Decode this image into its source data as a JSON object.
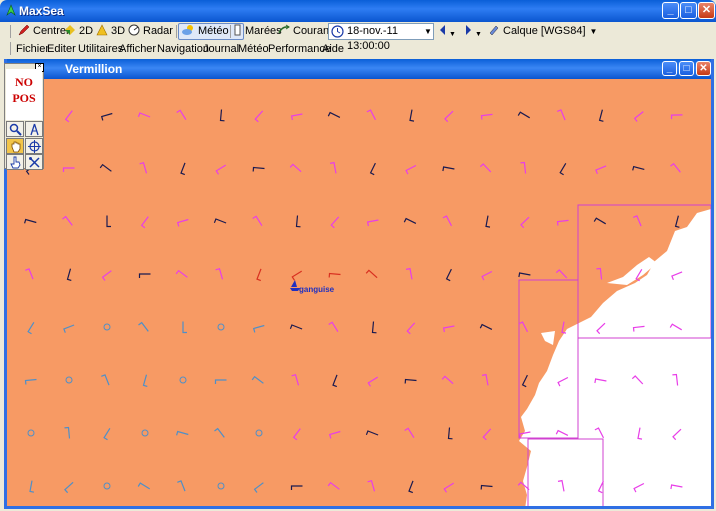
{
  "app": {
    "title": "MaxSea"
  },
  "window_controls": {
    "minimize": "_",
    "maximize": "□",
    "close": "✕"
  },
  "toolbar": {
    "centrer": "Centrer",
    "view_2d": "2D",
    "view_3d": "3D",
    "radar": "Radar",
    "meteo": "Météo",
    "marees": "Marées",
    "courants": "Courants",
    "datetime": "18-nov.-11 13:00:00",
    "calque": "Calque [WGS84]"
  },
  "menu": [
    "Fichier",
    "Editer",
    "Utilitaires",
    "Afficher",
    "Navigation",
    "Journal",
    "Météo",
    "Performance",
    "Aide"
  ],
  "chart_window": {
    "title": "Vermillion"
  },
  "palette": {
    "line1": "NO",
    "line2": "POS"
  },
  "boat": {
    "name": "ganguise"
  },
  "colors": {
    "sea": "#f79a64",
    "land": "#ffffff",
    "xp_blue": "#0a5fd8",
    "wind_navy": "#1a1a50",
    "wind_magenta": "#e83ee8",
    "wind_steel": "#4f8fc8",
    "wind_red": "#d83020",
    "chart_frame": "#d040d0"
  }
}
